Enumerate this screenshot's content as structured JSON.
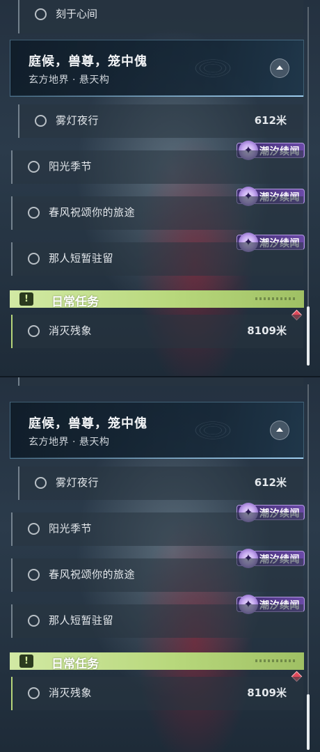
{
  "top_quest": {
    "title": "刻于心间"
  },
  "quest_group": {
    "title": "庭候，兽尊，笼中傀",
    "subtitle": "玄方地界 · 悬天构"
  },
  "quests": [
    {
      "title": "雾灯夜行",
      "distance": "612米"
    },
    {
      "title": "阳光季节",
      "tag": "潮汐续闻"
    },
    {
      "title": "春风祝颂你的旅途",
      "tag": "潮汐续闻"
    },
    {
      "title": "那人短暂驻留",
      "tag": "潮汐续闻"
    }
  ],
  "daily": {
    "title": "日常任务",
    "icon_glyph": "!",
    "quest": {
      "title": "消灭残象",
      "distance": "8109米"
    }
  },
  "icons": {
    "tag_icon": "tidal-echo-icon",
    "collapse": "collapse-up-icon",
    "daily_icon": "alert-icon",
    "marker": "red-diamond-marker-icon"
  },
  "colors": {
    "daily_accent": "#b8d87c",
    "tag_purple": "#6b4aa8",
    "marker_red": "#e0495a"
  }
}
